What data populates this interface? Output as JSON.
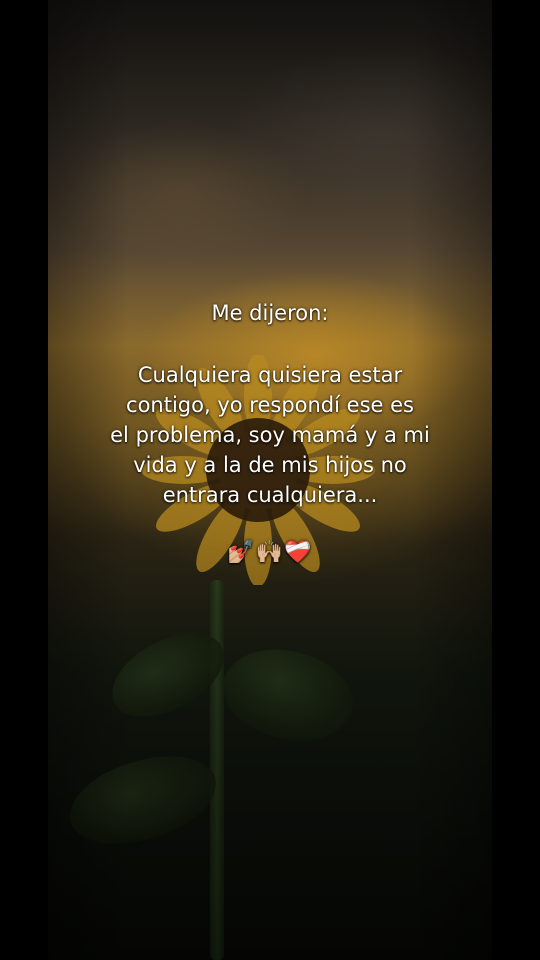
{
  "caption": {
    "title": "Me dijeron:",
    "lines": [
      "Cualquiera quisiera estar",
      "contigo, yo respondí ese es",
      "el problema, soy mamá y a mi",
      "vida y a la de mis hijos no",
      "entrara cualquiera..."
    ],
    "emojis": "💅🏼🙌🏼❤️‍🩹"
  },
  "background": {
    "subject": "sunflower at sunset",
    "colors": {
      "sky_glow": "#8a6a2d",
      "petal": "#b88a1f",
      "foliage": "#141a10",
      "letterbox": "#000000"
    }
  }
}
